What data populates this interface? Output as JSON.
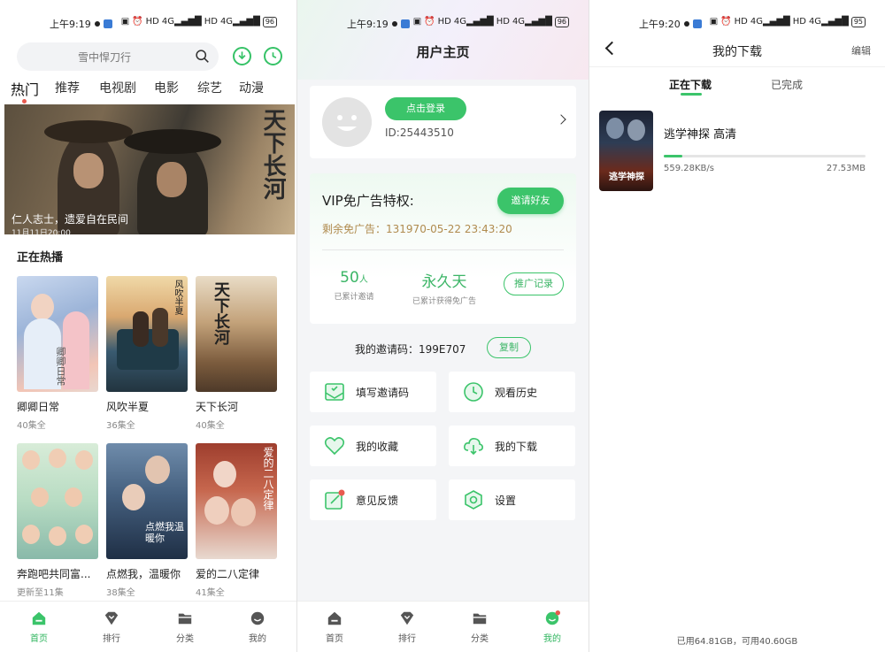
{
  "status_bars": [
    {
      "time": "上午9:19",
      "battery": "96"
    },
    {
      "time": "上午9:19",
      "battery": "96"
    },
    {
      "time": "上午9:20",
      "battery": "95"
    }
  ],
  "home": {
    "search_placeholder": "雪中悍刀行",
    "tabs": [
      "热门",
      "推荐",
      "电视剧",
      "电影",
      "综艺",
      "动漫"
    ],
    "banner": {
      "title": "天下长河",
      "caption": "仁人志士，遗爱自在民间",
      "subcaption": "11月11日20:00"
    },
    "section_title": "正在热播",
    "posters": [
      {
        "title": "卿卿日常",
        "sub": "40集全",
        "overlay": "卿卿日常"
      },
      {
        "title": "风吹半夏",
        "sub": "36集全",
        "overlay": "风吹半夏"
      },
      {
        "title": "天下长河",
        "sub": "40集全",
        "overlay": "天下长河"
      },
      {
        "title": "奔跑吧共同富...",
        "sub": "更新至11集",
        "overlay": ""
      },
      {
        "title": "点燃我，温暖你",
        "sub": "38集全",
        "overlay": "点燃我温暖你"
      },
      {
        "title": "爱的二八定律",
        "sub": "41集全",
        "overlay": "爱的二八定律"
      }
    ]
  },
  "bottom_nav": [
    {
      "label": "首页",
      "icon": "home-icon"
    },
    {
      "label": "排行",
      "icon": "rank-icon"
    },
    {
      "label": "分类",
      "icon": "folder-icon"
    },
    {
      "label": "我的",
      "icon": "user-icon"
    }
  ],
  "profile": {
    "title": "用户主页",
    "login_label": "点击登录",
    "user_id": "ID:25443510",
    "vip_title": "VIP免广告特权:",
    "invite_friends": "邀请好友",
    "remaining_label": "剩余免广告：",
    "remaining_value": "131970-05-22 23:43:20",
    "invited_count": "50",
    "invited_unit": "人",
    "invited_label": "已累计邀请",
    "ad_free_value": "永久天",
    "ad_free_label": "已累计获得免广告",
    "promo_record": "推广记录",
    "invite_code_label": "我的邀请码：",
    "invite_code": "199E707",
    "copy_label": "复制",
    "menu": [
      {
        "label": "填写邀请码",
        "icon": "invite-code-icon"
      },
      {
        "label": "观看历史",
        "icon": "clock-icon"
      },
      {
        "label": "我的收藏",
        "icon": "heart-icon"
      },
      {
        "label": "我的下载",
        "icon": "cloud-download-icon"
      },
      {
        "label": "意见反馈",
        "icon": "edit-icon"
      },
      {
        "label": "设置",
        "icon": "settings-icon"
      }
    ]
  },
  "downloads": {
    "title": "我的下载",
    "edit_label": "编辑",
    "tabs": [
      "正在下载",
      "已完成"
    ],
    "item": {
      "title": "逃学神探 高清",
      "speed": "559.28KB/s",
      "size": "27.53MB",
      "progress": 0.09,
      "poster_text": "逃学神探"
    },
    "storage": "已用64.81GB，可用40.60GB"
  },
  "colors": {
    "accent": "#3bc46a",
    "gold": "#b08b4f",
    "badge": "#e85a4f"
  }
}
